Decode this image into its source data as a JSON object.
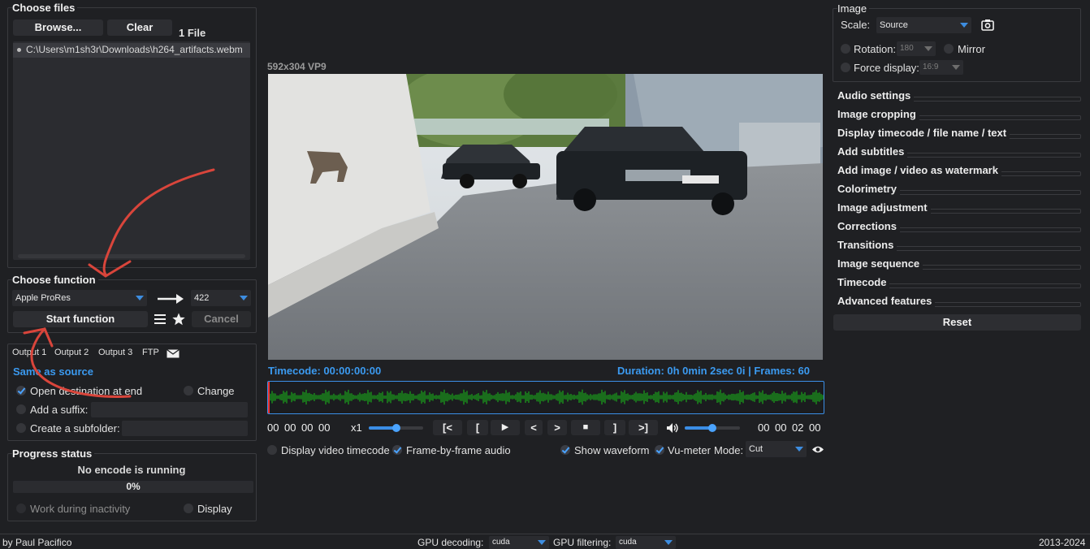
{
  "files": {
    "title": "Choose files",
    "browse_label": "Browse...",
    "clear_label": "Clear",
    "count": "1 File",
    "items": [
      "C:\\Users\\m1sh3r\\Downloads\\h264_artifacts.webm"
    ]
  },
  "function": {
    "title": "Choose function",
    "codec": "Apple ProRes",
    "profile": "422",
    "start_label": "Start function",
    "cancel_label": "Cancel"
  },
  "output": {
    "tabs": [
      "Output 1",
      "Output 2",
      "Output 3",
      "FTP"
    ],
    "destination": "Same as source",
    "open_destination": "Open destination at end",
    "change": "Change",
    "suffix_label": "Add a suffix:",
    "suffix_value": "",
    "subfolder_label": "Create a subfolder:",
    "subfolder_value": ""
  },
  "progress": {
    "title": "Progress status",
    "status": "No encode is running",
    "percent": "0%",
    "percent_value": 0,
    "work_inactivity": "Work during inactivity",
    "display": "Display"
  },
  "player": {
    "video_info": "592x304 VP9",
    "timecode": "Timecode: 00:00:00:00",
    "duration": "Duration: 0h 0min 2sec 0i | Frames: 60",
    "in_tc": [
      "00",
      "00",
      "00",
      "00"
    ],
    "out_tc": [
      "00",
      "00",
      "02",
      "00"
    ],
    "speed": "x1",
    "buttons": [
      "[<",
      "[",
      "▶",
      "<",
      ">",
      "■",
      "]",
      ">]"
    ],
    "display_timecode": "Display video timecode",
    "frame_audio": "Frame-by-frame audio",
    "show_waveform": "Show waveform",
    "vu_meter": "Vu-meter",
    "mode_label": "Mode:",
    "mode_value": "Cut",
    "speed_level": 0.5,
    "volume_level": 0.5
  },
  "image": {
    "title": "Image",
    "scale_label": "Scale:",
    "scale_value": "Source",
    "rotation_label": "Rotation:",
    "rotation_value": "180",
    "mirror": "Mirror",
    "force_display_label": "Force display:",
    "force_display_value": "16:9"
  },
  "sections": [
    "Audio settings",
    "Image cropping",
    "Display timecode / file name / text",
    "Add subtitles",
    "Add image / video as watermark",
    "Colorimetry",
    "Image adjustment",
    "Corrections",
    "Transitions",
    "Image sequence",
    "Timecode",
    "Advanced features"
  ],
  "reset_label": "Reset",
  "footer": {
    "author": "by Paul Pacifico",
    "gpu_decoding_label": "GPU decoding:",
    "gpu_decoding_value": "cuda",
    "gpu_filtering_label": "GPU filtering:",
    "gpu_filtering_value": "cuda",
    "years": "2013-2024"
  },
  "colors": {
    "accent": "#3b9af0",
    "waveform": "#1aa51a",
    "annotation": "#d9453b"
  }
}
